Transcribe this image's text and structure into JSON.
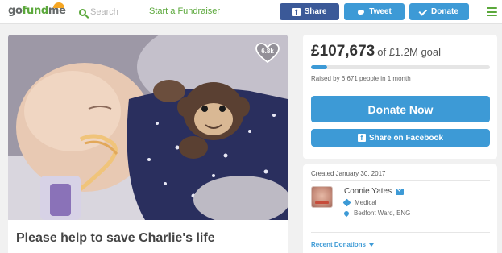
{
  "header": {
    "logo": {
      "go": "go",
      "fund": "fund",
      "me": "me"
    },
    "search_placeholder": "Search",
    "start_fundraiser": "Start a Fundraiser",
    "share_label": "Share",
    "tweet_label": "Tweet",
    "donate_label": "Donate"
  },
  "campaign": {
    "title": "Please help to save Charlie's life",
    "hearts": "6.8k",
    "photo_alt": "photo"
  },
  "donate_panel": {
    "amount": "£107,673",
    "goal": "of £1.2M goal",
    "progress_fraction": 0.09,
    "raised_by": "Raised by 6,671 people in 1 month",
    "donate_now": "Donate Now",
    "share_facebook": "Share on Facebook"
  },
  "organizer": {
    "created": "Created January 30, 2017",
    "name": "Connie Yates",
    "category": "Medical",
    "location": "Bedfont Ward, ENG",
    "recent_donations": "Recent Donations"
  },
  "colors": {
    "brand_green": "#5ba83b",
    "facebook_blue": "#3b5998",
    "accent_blue": "#3d9ad6"
  },
  "icons": [
    "search-icon",
    "facebook-icon",
    "twitter-icon",
    "check-icon",
    "hamburger-menu-icon",
    "heart-icon",
    "email-icon",
    "tag-icon",
    "location-pin-icon",
    "caret-down-icon"
  ]
}
